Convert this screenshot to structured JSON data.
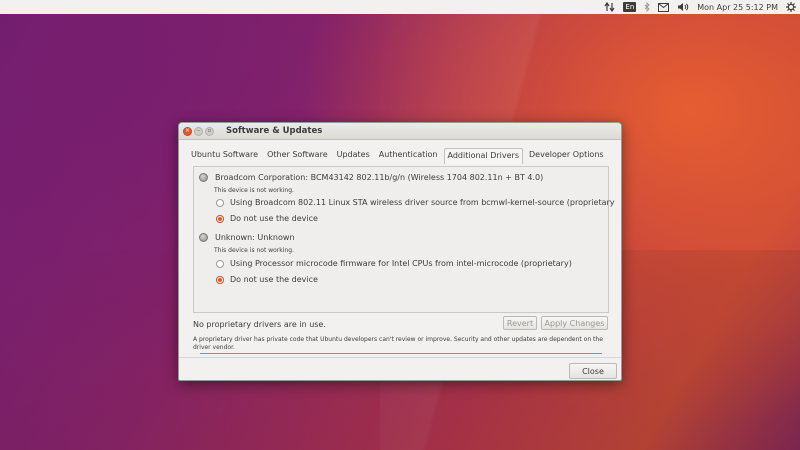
{
  "top_panel": {
    "keyboard": "En",
    "datetime": "Mon Apr 25  5:12 PM"
  },
  "window": {
    "title": "Software & Updates",
    "tabs": [
      {
        "label": "Ubuntu Software"
      },
      {
        "label": "Other Software"
      },
      {
        "label": "Updates"
      },
      {
        "label": "Authentication"
      },
      {
        "label": "Additional Drivers"
      },
      {
        "label": "Developer Options"
      }
    ],
    "active_tab": "Additional Drivers"
  },
  "drivers": [
    {
      "device": "Broadcom Corporation: BCM43142 802.11b/g/n (Wireless 1704 802.11n + BT 4.0)",
      "status": "This device is not working.",
      "options": [
        {
          "label": "Using Broadcom 802.11 Linux STA wireless driver source from bcmwl-kernel-source (proprietary",
          "selected": false
        },
        {
          "label": "Do not use the device",
          "selected": true
        }
      ]
    },
    {
      "device": "Unknown: Unknown",
      "status": "This device is not working.",
      "options": [
        {
          "label": "Using Processor microcode firmware for Intel CPUs from intel-microcode (proprietary)",
          "selected": false
        },
        {
          "label": "Do not use the device",
          "selected": true
        }
      ]
    }
  ],
  "status_text": "No proprietary drivers are in use.",
  "buttons": {
    "revert": "Revert",
    "apply": "Apply Changes",
    "close": "Close"
  },
  "note": "A proprietary driver has private code that Ubuntu developers can't review or improve. Security and other updates are dependent on the driver vendor.",
  "colors": {
    "accent": "#e0582a",
    "progress_line": "#e0773f"
  }
}
